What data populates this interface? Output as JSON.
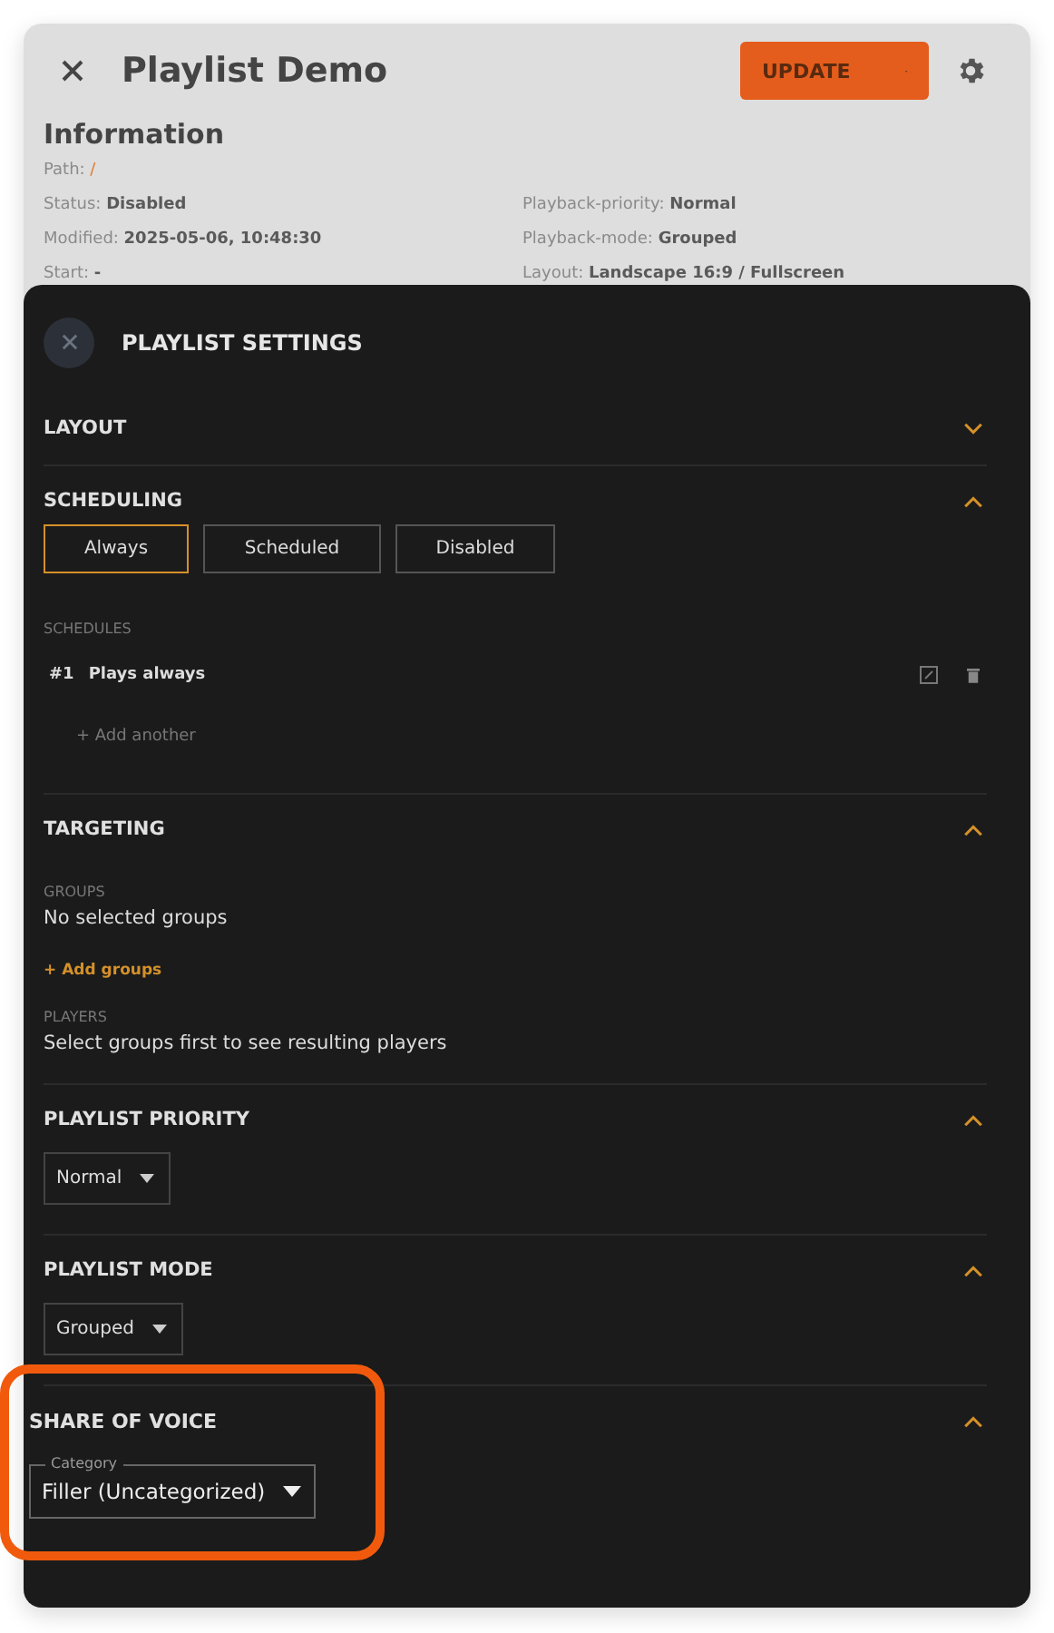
{
  "header": {
    "title": "Playlist Demo",
    "update_button": "UPDATE"
  },
  "information": {
    "heading": "Information",
    "rows": [
      [
        {
          "label": "Path:",
          "value": "/",
          "kind": "link"
        }
      ],
      [
        {
          "label": "Status:",
          "value": "Disabled",
          "kind": "text"
        },
        {
          "label": "Playback-priority:",
          "value": "Normal",
          "kind": "text"
        }
      ],
      [
        {
          "label": "Modified:",
          "value": "2025-05-06, 10:48:30",
          "kind": "text"
        },
        {
          "label": "Playback-mode:",
          "value": "Grouped",
          "kind": "text"
        }
      ],
      [
        {
          "label": "Start:",
          "value": "-",
          "kind": "text"
        },
        {
          "label": "Layout:",
          "value": "Landscape 16:9 / Fullscreen",
          "kind": "text"
        }
      ]
    ]
  },
  "settings": {
    "title": "PLAYLIST SETTINGS",
    "sections": [
      {
        "kind": "layout",
        "title": "LAYOUT",
        "expanded": false,
        "highlighted": false
      },
      {
        "kind": "scheduling",
        "title": "SCHEDULING",
        "expanded": true,
        "highlighted": false,
        "modes": [
          {
            "label": "Always",
            "selected": true
          },
          {
            "label": "Scheduled",
            "selected": false
          },
          {
            "label": "Disabled",
            "selected": false
          }
        ],
        "schedules_label": "SCHEDULES",
        "schedules": [
          {
            "number": "#1",
            "text": "Plays always"
          }
        ],
        "add_link": "+ Add another"
      },
      {
        "kind": "targeting",
        "title": "TARGETING",
        "expanded": true,
        "highlighted": false,
        "groups_label": "GROUPS",
        "groups_text": "No selected groups",
        "add_link": "+ Add groups",
        "players_label": "PLAYERS",
        "players_text": "Select groups first to see resulting players"
      },
      {
        "kind": "dropdown",
        "title": "PLAYLIST PRIORITY",
        "expanded": true,
        "highlighted": false,
        "value": "Normal"
      },
      {
        "kind": "dropdown",
        "title": "PLAYLIST MODE",
        "expanded": true,
        "highlighted": false,
        "value": "Grouped"
      },
      {
        "kind": "field",
        "title": "SHARE OF VOICE",
        "expanded": true,
        "highlighted": true,
        "label": "Category",
        "value": "Filler (Uncategorized)"
      }
    ]
  }
}
